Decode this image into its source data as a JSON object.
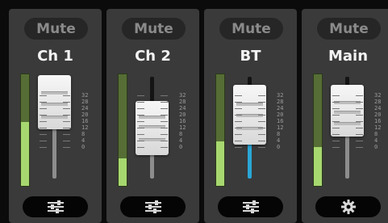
{
  "channels": [
    {
      "mute_label": "Mute",
      "name": "Ch 1",
      "meter_level": 0.57,
      "bottom_icon": "sliders-icon"
    },
    {
      "mute_label": "Mute",
      "name": "Ch 2",
      "meter_level": 0.25,
      "bottom_icon": "sliders-icon"
    },
    {
      "mute_label": "Mute",
      "name": "BT",
      "meter_level": 0.4,
      "bottom_icon": "sliders-icon"
    },
    {
      "mute_label": "Mute",
      "name": "Main",
      "meter_level": 0.35,
      "bottom_icon": "gear-icon"
    }
  ],
  "scale_labels": [
    "32",
    "28",
    "24",
    "20",
    "16",
    "12",
    "8",
    "4",
    "0"
  ],
  "colors": {
    "meter_fill": "#a7d870",
    "bt_rail": "#2aa6d6"
  }
}
